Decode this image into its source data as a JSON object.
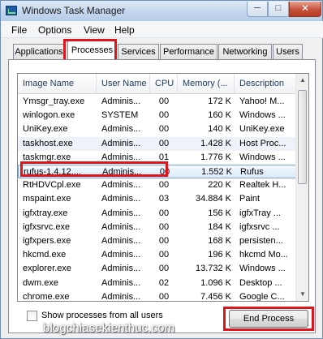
{
  "window": {
    "title": "Windows Task Manager"
  },
  "menu": [
    "File",
    "Options",
    "View",
    "Help"
  ],
  "tabs": [
    {
      "label": "Applications"
    },
    {
      "label": "Processes",
      "active": true
    },
    {
      "label": "Services"
    },
    {
      "label": "Performance"
    },
    {
      "label": "Networking"
    },
    {
      "label": "Users"
    }
  ],
  "table": {
    "columns": [
      "Image Name",
      "User Name",
      "CPU",
      "Memory (...",
      "Description"
    ],
    "rows": [
      [
        "Ymsgr_tray.exe",
        "Adminis...",
        "00",
        "172 K",
        "Yahoo! M..."
      ],
      [
        "winlogon.exe",
        "SYSTEM",
        "00",
        "160 K",
        "Windows ..."
      ],
      [
        "UniKey.exe",
        "Adminis...",
        "00",
        "140 K",
        "UniKey.exe"
      ],
      [
        "taskhost.exe",
        "Adminis...",
        "00",
        "1.428 K",
        "Host Proc..."
      ],
      [
        "taskmgr.exe",
        "Adminis...",
        "01",
        "1.776 K",
        "Windows ..."
      ],
      [
        "rufus-1.4.12....",
        "Adminis...",
        "00",
        "1.552 K",
        "Rufus"
      ],
      [
        "RtHDVCpl.exe",
        "Adminis...",
        "00",
        "220 K",
        "Realtek H..."
      ],
      [
        "mspaint.exe",
        "Adminis...",
        "03",
        "34.884 K",
        "Paint"
      ],
      [
        "igfxtray.exe",
        "Adminis...",
        "00",
        "156 K",
        "igfxTray ..."
      ],
      [
        "igfxsrvc.exe",
        "Adminis...",
        "00",
        "184 K",
        "igfxsrvc ..."
      ],
      [
        "igfxpers.exe",
        "Adminis...",
        "00",
        "168 K",
        "persisten..."
      ],
      [
        "hkcmd.exe",
        "Adminis...",
        "00",
        "196 K",
        "hkcmd Mo..."
      ],
      [
        "explorer.exe",
        "Adminis...",
        "00",
        "13.732 K",
        "Windows ..."
      ],
      [
        "dwm.exe",
        "Adminis...",
        "02",
        "1.096 K",
        "Desktop ..."
      ],
      [
        "chrome.exe",
        "Adminis...",
        "00",
        "7.456 K",
        "Google C..."
      ]
    ],
    "selected_row": 5
  },
  "show_all_label": "Show processes from all users",
  "end_process_label": "End Process",
  "watermark": "blogchiasekienthuc.com",
  "colors": {
    "highlight": "#e0151b",
    "selection": "#7da2ce",
    "header_text": "#1e395b"
  }
}
